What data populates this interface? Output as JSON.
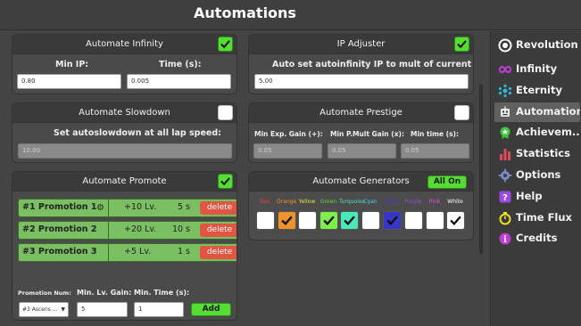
{
  "header": {
    "title": "Automations"
  },
  "infinity": {
    "title": "Automate Infinity",
    "enabled": true,
    "min_ip_label": "Min IP:",
    "min_ip_value": "0.80",
    "time_label": "Time (s):",
    "time_value": "0.005"
  },
  "ip_adjuster": {
    "title": "IP Adjuster",
    "enabled": true,
    "desc": "Auto set autoinfinity IP to mult of current IP:",
    "value": "5.00"
  },
  "slowdown": {
    "title": "Automate Slowdown",
    "enabled": false,
    "desc": "Set autoslowdown at all lap speed:",
    "value": "10.00"
  },
  "prestige": {
    "title": "Automate Prestige",
    "enabled": false,
    "min_exp_label": "Min Exp. Gain (+):",
    "min_exp_value": "0.05",
    "min_pmult_label": "Min P.Mult Gain (x):",
    "min_pmult_value": "0.05",
    "min_time_label": "Min time (s):",
    "min_time_value": "0.05"
  },
  "promote": {
    "title": "Automate Promote",
    "enabled": true,
    "rows": [
      {
        "name": "#1 Promotion 1",
        "level": "+10 Lv.",
        "seconds": "5 s",
        "delete": "delete",
        "has_gear": true
      },
      {
        "name": "#2 Promotion 2",
        "level": "+20 Lv.",
        "seconds": "10 s",
        "delete": "delete",
        "has_gear": false
      },
      {
        "name": "#3 Promotion 3",
        "level": "+5 Lv.",
        "seconds": "1 s",
        "delete": "delete",
        "has_gear": false
      }
    ],
    "promo_num_label": "Promotion Num:",
    "promo_num_value": "#3 Ascens ...",
    "min_lv_label": "Min. Lv. Gain:",
    "min_lv_value": "5",
    "min_time_label": "Min. Time (s):",
    "min_time_value": "1",
    "add_label": "Add"
  },
  "generators": {
    "title": "Automate Generators",
    "all_on_label": "All On",
    "items": [
      {
        "name": "Red",
        "color": "#e03c3c",
        "box": "#ffffff",
        "checked": false
      },
      {
        "name": "Orange",
        "color": "#f0922a",
        "box": "#f0922a",
        "checked": true
      },
      {
        "name": "Yellow",
        "color": "#e6e23a",
        "box": "#ffffff",
        "checked": false
      },
      {
        "name": "Green",
        "color": "#58e03a",
        "box": "#7cf04a",
        "checked": true
      },
      {
        "name": "Turquoise",
        "color": "#4ae0c0",
        "box": "#48e8b8",
        "checked": true
      },
      {
        "name": "Cyan",
        "color": "#4ad8f0",
        "box": "#ffffff",
        "checked": false
      },
      {
        "name": "Blue",
        "color": "#3a3ae0",
        "box": "#3636c8",
        "checked": true
      },
      {
        "name": "Purple",
        "color": "#9a4ae0",
        "box": "#ffffff",
        "checked": false
      },
      {
        "name": "Pink",
        "color": "#f04ae0",
        "box": "#ffffff",
        "checked": false
      },
      {
        "name": "White",
        "color": "#ffffff",
        "box": "#ffffff",
        "checked": true
      }
    ]
  },
  "sidebar": {
    "items": [
      {
        "label": "Revolution",
        "icon": "revolution-icon",
        "active": false
      },
      {
        "label": "Infinity",
        "icon": "infinity-icon",
        "active": false
      },
      {
        "label": "Eternity",
        "icon": "eternity-icon",
        "active": false
      },
      {
        "label": "Automations",
        "icon": "robot-icon",
        "active": true
      },
      {
        "label": "Achievem...",
        "icon": "achievement-icon",
        "active": false
      },
      {
        "label": "Statistics",
        "icon": "statistics-icon",
        "active": false
      },
      {
        "label": "Options",
        "icon": "gear-icon",
        "active": false
      },
      {
        "label": "Help",
        "icon": "help-icon",
        "active": false
      },
      {
        "label": "Time Flux",
        "icon": "time-flux-icon",
        "active": false
      },
      {
        "label": "Credits",
        "icon": "credits-icon",
        "active": false
      }
    ]
  },
  "colors": {
    "checkbox_on": "#55dd33",
    "delete_button": "#e45443",
    "promo_row": "#7bbf63",
    "background": "#444444"
  }
}
